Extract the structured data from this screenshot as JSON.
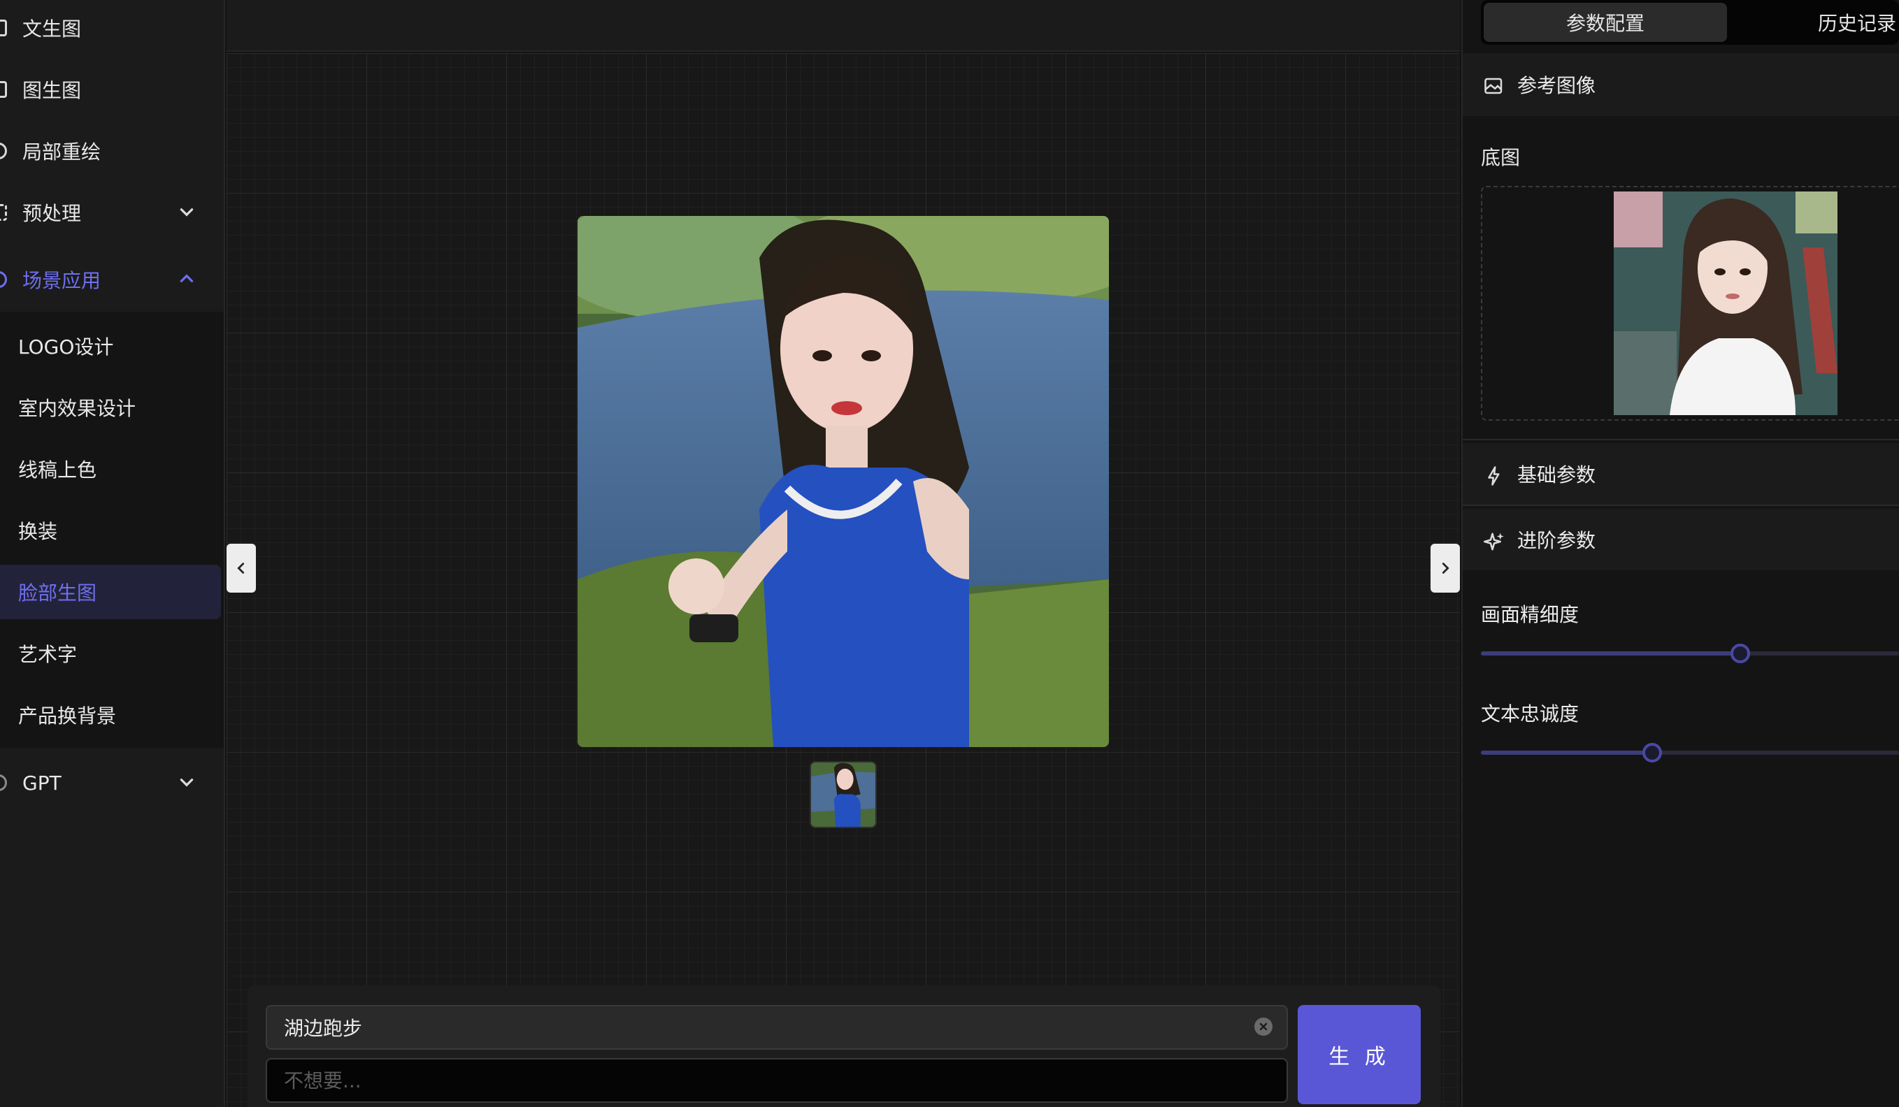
{
  "sidebar": {
    "items": [
      {
        "label": "文生图",
        "icon": "image-frame-icon"
      },
      {
        "label": "图生图",
        "icon": "image-frame-icon"
      },
      {
        "label": "局部重绘",
        "icon": "brush-icon"
      },
      {
        "label": "预处理",
        "icon": "process-icon"
      },
      {
        "label": "场景应用",
        "icon": "scene-icon"
      },
      {
        "label": "GPT",
        "icon": "gpt-icon"
      }
    ],
    "submenu": [
      "LOGO设计",
      "室内效果设计",
      "线稿上色",
      "换装",
      "脸部生图",
      "艺术字",
      "产品换背景"
    ],
    "active_sub": "脸部生图"
  },
  "prompt": {
    "value": "湖边跑步",
    "negative_placeholder": "不想要...",
    "generate_label": "生 成"
  },
  "right_panel": {
    "tabs": [
      "参数配置",
      "历史记录"
    ],
    "active_tab": "参数配置",
    "reference_section": "参考图像",
    "base_image_label": "底图",
    "basic_params": "基础参数",
    "advanced_params": "进阶参数",
    "sliders": [
      {
        "label": "画面精细度",
        "fraction": 0.62
      },
      {
        "label": "文本忠诚度",
        "fraction": 0.41
      }
    ]
  },
  "colors": {
    "accent": "#6f6ff0",
    "button": "#5a57d6",
    "background": "#141414"
  }
}
